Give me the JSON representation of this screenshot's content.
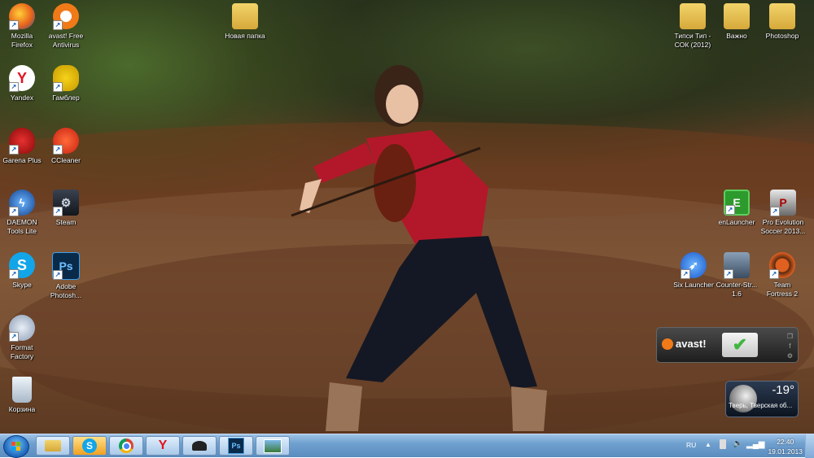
{
  "desktop": {
    "left_icons": [
      {
        "label": "Mozilla Firefox",
        "icon": "firefox-icon"
      },
      {
        "label": "avast! Free Antivirus",
        "icon": "avast-icon"
      },
      {
        "label": "Yandex",
        "icon": "yandex-icon"
      },
      {
        "label": "Гамблер",
        "icon": "gambler-icon"
      },
      {
        "label": "Garena Plus",
        "icon": "garena-icon"
      },
      {
        "label": "CCleaner",
        "icon": "ccleaner-icon"
      },
      {
        "label": "DAEMON Tools Lite",
        "icon": "daemon-tools-icon"
      },
      {
        "label": "Steam",
        "icon": "steam-icon"
      },
      {
        "label": "Skype",
        "icon": "skype-icon"
      },
      {
        "label": "Adobe Photosh...",
        "icon": "photoshop-icon"
      },
      {
        "label": "Format Factory",
        "icon": "format-factory-icon"
      },
      {
        "label": "Корзина",
        "icon": "recycle-bin-icon"
      }
    ],
    "middle_icons": [
      {
        "label": "Новая папка",
        "icon": "folder-icon"
      }
    ],
    "right_top_icons": [
      {
        "label": "Типси Тип - СОК (2012)",
        "icon": "folder-icon"
      },
      {
        "label": "Важно",
        "icon": "folder-icon"
      },
      {
        "label": "Photoshop",
        "icon": "folder-icon"
      }
    ],
    "right_icons": [
      {
        "label": "enLauncher",
        "icon": "enlauncher-icon"
      },
      {
        "label": "Pro Evolution Soccer 2013...",
        "icon": "pes-icon"
      },
      {
        "label": "Six Launcher",
        "icon": "six-launcher-icon"
      },
      {
        "label": "Counter-Str... 1.6",
        "icon": "counter-strike-icon"
      },
      {
        "label": "Team Fortress 2",
        "icon": "tf2-icon"
      }
    ]
  },
  "gadgets": {
    "avast": {
      "brand": "avast!",
      "status_icon": "checkmark-icon"
    },
    "weather": {
      "temperature": "-19°",
      "location": "Тверь, Тверская об..."
    }
  },
  "taskbar": {
    "pinned": [
      {
        "name": "explorer",
        "icon": "folder-icon"
      },
      {
        "name": "skype",
        "icon": "skype-icon"
      },
      {
        "name": "chrome",
        "icon": "chrome-icon"
      },
      {
        "name": "yandex",
        "icon": "yandex-icon"
      },
      {
        "name": "gambler",
        "icon": "spy-hat-icon"
      },
      {
        "name": "photoshop",
        "icon": "photoshop-icon"
      },
      {
        "name": "screenshot",
        "icon": "image-viewer-icon"
      }
    ],
    "tray": {
      "language": "RU",
      "time": "22:40",
      "date": "19.01.2013"
    }
  },
  "colors": {
    "taskbar": "#6fa0cf",
    "avast_orange": "#f07a18",
    "check_green": "#3fb63f"
  }
}
